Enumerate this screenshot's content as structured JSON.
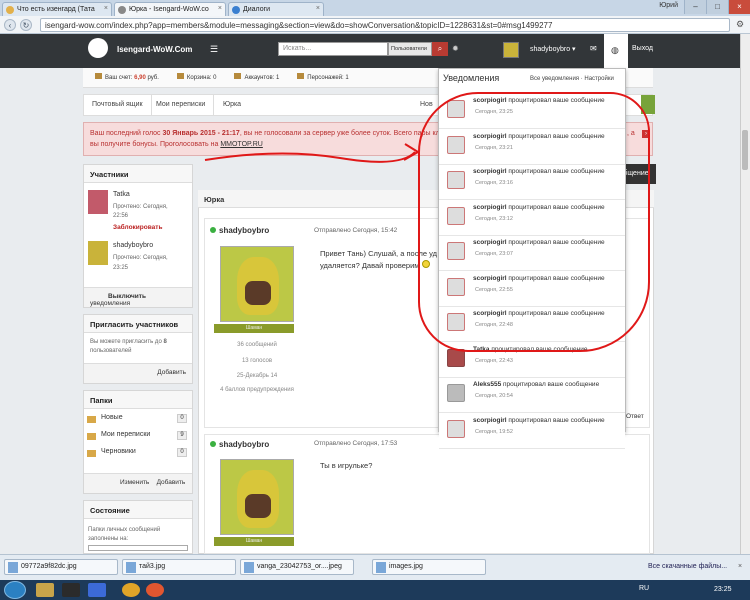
{
  "browser": {
    "tabs": [
      {
        "label": "Что есть изенгард (Тата"
      },
      {
        "label": "Юрка - Isengard-WoW.co"
      },
      {
        "label": "Диалоги"
      }
    ],
    "user": "Юрий",
    "url": "isengard-wow.com/index.php?app=members&module=messaging&section=view&do=showConversation&topicID=1228631&st=0#msg1499277"
  },
  "site": {
    "logo": "Isengard-WoW.Com",
    "search_placeholder": "Искать...",
    "search_scope": "Пользователи",
    "username": "shadyboybro",
    "logout": "Выход"
  },
  "stats": {
    "account": "Ваш счет:",
    "balance": "6,90",
    "currency": "руб.",
    "cart": "Корзина: 0",
    "accounts": "Аккаунтов: 1",
    "chars": "Персонажей: 1"
  },
  "breadcrumbs": [
    "Почтовый ящик",
    "Мои переписки",
    "Юрка",
    "Нов"
  ],
  "alert": {
    "pre": "Ваш последний голос",
    "date": "30 Январь 2015 - 21:17",
    "mid": ", вы не голосовали за сервер уже более суток. Всего пары кликов и",
    "tail": "вы получите бонусы. Проголосовать на",
    "link": "MMOTOP.RU",
    "end": ", а"
  },
  "reply_label": "сообщение",
  "participants": {
    "title": "Участники",
    "items": [
      {
        "name": "Tatka",
        "line1": "Прочтено: Сегодня,",
        "line2": "22:56",
        "action": "Заблокировать"
      },
      {
        "name": "shadyboybro",
        "line1": "Прочтено: Сегодня,",
        "line2": "23:25"
      }
    ],
    "foot_bold": "Выключить",
    "foot": "уведомления"
  },
  "invite": {
    "title": "Пригласить участников",
    "text": "Вы можете пригласить до",
    "num": "8",
    "text2": "пользователей",
    "button": "Добавить"
  },
  "folders": {
    "title": "Папки",
    "items": [
      {
        "name": "Новые",
        "count": "0"
      },
      {
        "name": "Мои переписки",
        "count": "9"
      },
      {
        "name": "Черновики",
        "count": "0"
      }
    ],
    "edit": "Изменить",
    "add": "Добавить"
  },
  "status": {
    "title": "Состояние",
    "text": "Папки личных сообщений заполнены на:"
  },
  "conversation": {
    "title": "Юрка",
    "posts": [
      {
        "author": "shadyboybro",
        "sent": "Отправлено Сегодня, 15:42",
        "rank": "Шаман",
        "body1": "Привет Тань) Слушай, а после уд",
        "body2": "удаляется? Давай проверим",
        "stat1": "36 сообщений",
        "stat2": "13 голосов",
        "stat3": "25-Декабрь 14",
        "stat4": "4 баллов предупреждения",
        "reply": "Ответ"
      },
      {
        "author": "shadyboybro",
        "sent": "Отправлено Сегодня, 17:53",
        "rank": "Шаман",
        "body1": "Ты в игрульке?"
      }
    ]
  },
  "notifications": {
    "title": "Уведомления",
    "all": "Все уведомления",
    "sep": "·",
    "settings": "Настройки",
    "items": [
      {
        "who": "scorpiogirl",
        "text": "процитировал ваше сообщение",
        "time": "Сегодня, 23:25",
        "avatar": "scorpio"
      },
      {
        "who": "scorpiogirl",
        "text": "процитировал ваше сообщение",
        "time": "Сегодня, 23:21",
        "avatar": "scorpio"
      },
      {
        "who": "scorpiogirl",
        "text": "процитировал ваше сообщение",
        "time": "Сегодня, 23:16",
        "avatar": "scorpio"
      },
      {
        "who": "scorpiogirl",
        "text": "процитировал ваше сообщение",
        "time": "Сегодня, 23:12",
        "avatar": "scorpio"
      },
      {
        "who": "scorpiogirl",
        "text": "процитировал ваше сообщение",
        "time": "Сегодня, 23:07",
        "avatar": "scorpio"
      },
      {
        "who": "scorpiogirl",
        "text": "процитировал ваше сообщение",
        "time": "Сегодня, 22:55",
        "avatar": "scorpio"
      },
      {
        "who": "scorpiogirl",
        "text": "процитировал ваше сообщение",
        "time": "Сегодня, 22:48",
        "avatar": "scorpio"
      },
      {
        "who": "Tatka",
        "text": "процитировал ваше сообщение",
        "time": "Сегодня, 22:43",
        "avatar": "girl"
      },
      {
        "who": "Aleks555",
        "text": "процитировал ваше сообщение",
        "time": "Сегодня, 20:54",
        "avatar": "grey"
      },
      {
        "who": "scorpiogirl",
        "text": "процитировал ваше сообщение",
        "time": "Сегодня, 19:52",
        "avatar": "scorpio"
      }
    ]
  },
  "downloads": {
    "items": [
      "09772a9f82dc.jpg",
      "тай3.jpg",
      "vanga_23042753_or....jpeg",
      "images.jpg"
    ],
    "all": "Все скачанные файлы..."
  },
  "taskbar": {
    "lang": "RU",
    "time": "23:25"
  }
}
